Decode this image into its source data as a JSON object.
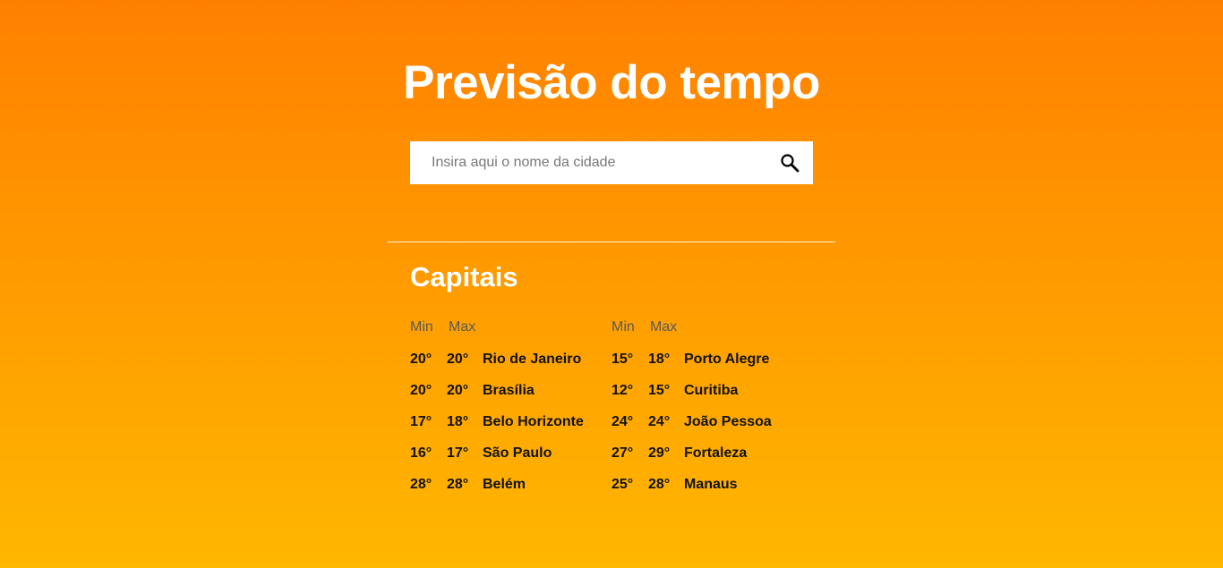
{
  "header": {
    "title": "Previsão do tempo"
  },
  "search": {
    "placeholder": "Insira aqui o nome da cidade",
    "value": "",
    "icon": "search-icon"
  },
  "capitals": {
    "title": "Capitais",
    "min_label": "Min",
    "max_label": "Max",
    "columns": [
      {
        "rows": [
          {
            "min": "20°",
            "max": "20°",
            "city": "Rio de Janeiro"
          },
          {
            "min": "20°",
            "max": "20°",
            "city": "Brasília"
          },
          {
            "min": "17°",
            "max": "18°",
            "city": "Belo Horizonte"
          },
          {
            "min": "16°",
            "max": "17°",
            "city": "São Paulo"
          },
          {
            "min": "28°",
            "max": "28°",
            "city": "Belém"
          }
        ]
      },
      {
        "rows": [
          {
            "min": "15°",
            "max": "18°",
            "city": "Porto Alegre"
          },
          {
            "min": "12°",
            "max": "15°",
            "city": "Curitiba"
          },
          {
            "min": "24°",
            "max": "24°",
            "city": "João Pessoa"
          },
          {
            "min": "27°",
            "max": "29°",
            "city": "Fortaleza"
          },
          {
            "min": "25°",
            "max": "28°",
            "city": "Manaus"
          }
        ]
      }
    ]
  },
  "colors": {
    "gradient_top": "#ff8000",
    "gradient_bottom": "#ffb700",
    "text_light": "#ffffff",
    "text_dark": "#111111",
    "header_gray": "#5a5a5a"
  }
}
